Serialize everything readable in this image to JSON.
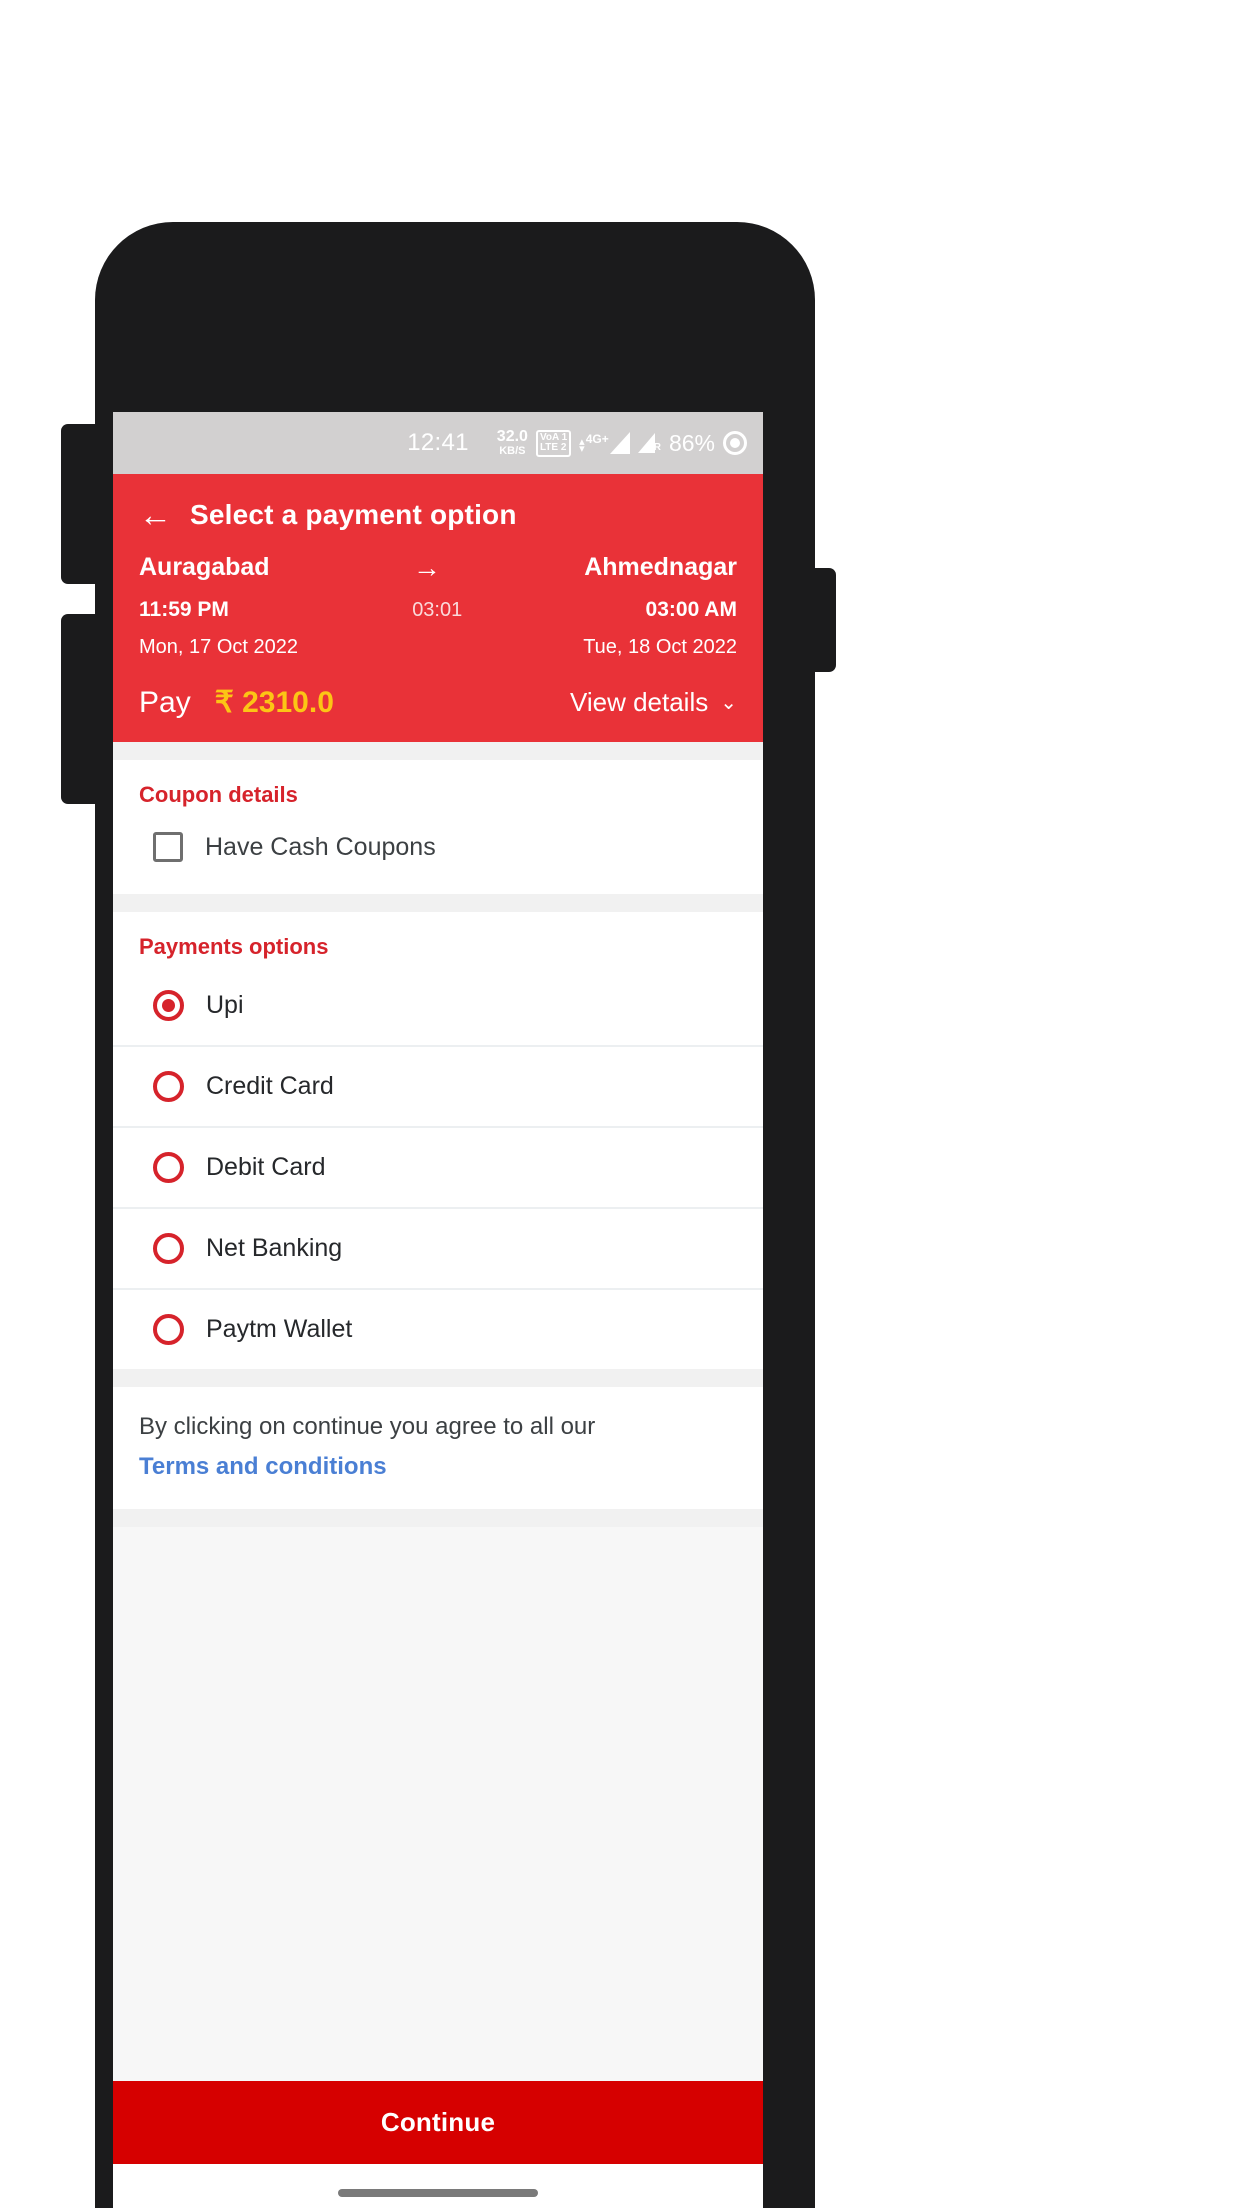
{
  "statusbar": {
    "time": "12:41",
    "data_rate": "32.0",
    "data_unit": "KB/S",
    "volte_line1": "VoA 1",
    "volte_line2": "LTE 2",
    "network_type": "4G+",
    "roaming": "R",
    "battery": "86%"
  },
  "appbar": {
    "back_icon": "back-arrow-icon",
    "title": "Select a payment option"
  },
  "journey": {
    "from_city": "Auragabad",
    "to_city": "Ahmednagar",
    "arrow_icon": "arrow-right-icon",
    "departure_time": "11:59 PM",
    "duration": "03:01",
    "arrival_time": "03:00 AM",
    "departure_date": "Mon, 17 Oct 2022",
    "arrival_date": "Tue, 18 Oct 2022"
  },
  "pay_summary": {
    "label": "Pay",
    "amount": "₹ 2310.0",
    "view_details_label": "View details",
    "chevron_icon": "chevron-down-icon"
  },
  "coupon": {
    "section_title": "Coupon details",
    "checkbox_label": "Have Cash Coupons",
    "checked": false
  },
  "payments": {
    "section_title": "Payments options",
    "options": [
      {
        "label": "Upi",
        "selected": true
      },
      {
        "label": "Credit Card",
        "selected": false
      },
      {
        "label": "Debit Card",
        "selected": false
      },
      {
        "label": "Net Banking",
        "selected": false
      },
      {
        "label": "Paytm Wallet",
        "selected": false
      }
    ]
  },
  "terms": {
    "text": "By clicking on continue you agree to all our",
    "link": "Terms and conditions"
  },
  "footer": {
    "continue_label": "Continue"
  },
  "colors": {
    "header_red": "#e93238",
    "button_red": "#d60000",
    "accent_red": "#d6232b",
    "amount_yellow": "#fcc515",
    "link_blue": "#4a7fd4",
    "statusbar_gray": "#d2d0d0"
  }
}
